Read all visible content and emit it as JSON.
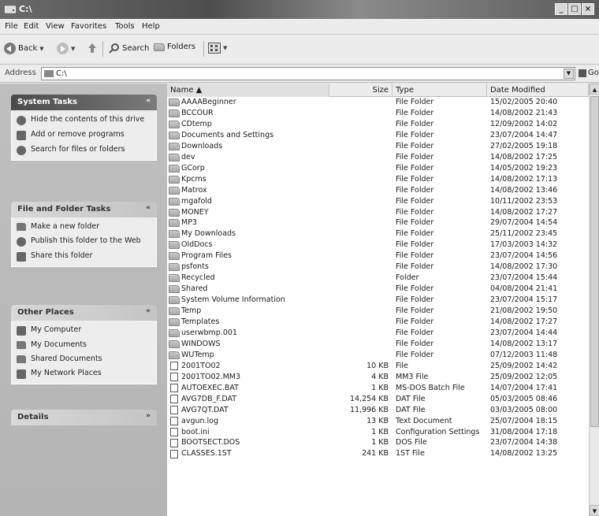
{
  "window": {
    "title": "C:\\"
  },
  "title_buttons": {
    "minimize": "_",
    "maximize": "□",
    "close": "×"
  },
  "menu": [
    "File",
    "Edit",
    "View",
    "Favorites",
    "Tools",
    "Help"
  ],
  "toolbar": {
    "back": "Back",
    "search": "Search",
    "folders": "Folders"
  },
  "address": {
    "label": "Address",
    "value": "C:\\",
    "go": "Go"
  },
  "task_panes": {
    "system_tasks": {
      "title": "System Tasks",
      "items": [
        "Hide the contents of this drive",
        "Add or remove programs",
        "Search for files or folders"
      ]
    },
    "file_folder_tasks": {
      "title": "File and Folder Tasks",
      "items": [
        "Make a new folder",
        "Publish this folder to the Web",
        "Share this folder"
      ]
    },
    "other_places": {
      "title": "Other Places",
      "items": [
        "My Computer",
        "My Documents",
        "Shared Documents",
        "My Network Places"
      ]
    },
    "details": {
      "title": "Details"
    }
  },
  "columns": {
    "name": "Name ▲",
    "size": "Size",
    "type": "Type",
    "date": "Date Modified"
  },
  "files": [
    {
      "name": "AAAABeginner",
      "size": "",
      "type": "File Folder",
      "date": "15/02/2005 20:40",
      "kind": "folder"
    },
    {
      "name": "BCCOUR",
      "size": "",
      "type": "File Folder",
      "date": "14/08/2002 21:43",
      "kind": "folder"
    },
    {
      "name": "CDtemp",
      "size": "",
      "type": "File Folder",
      "date": "12/09/2002 14:02",
      "kind": "folder"
    },
    {
      "name": "Documents and Settings",
      "size": "",
      "type": "File Folder",
      "date": "23/07/2004 14:47",
      "kind": "folder"
    },
    {
      "name": "Downloads",
      "size": "",
      "type": "File Folder",
      "date": "27/02/2005 19:18",
      "kind": "folder"
    },
    {
      "name": "dev",
      "size": "",
      "type": "File Folder",
      "date": "14/08/2002 17:25",
      "kind": "folder"
    },
    {
      "name": "GCorp",
      "size": "",
      "type": "File Folder",
      "date": "14/05/2002 19:23",
      "kind": "folder"
    },
    {
      "name": "Kpcms",
      "size": "",
      "type": "File Folder",
      "date": "14/08/2002 17:13",
      "kind": "folder"
    },
    {
      "name": "Matrox",
      "size": "",
      "type": "File Folder",
      "date": "14/08/2002 13:46",
      "kind": "folder"
    },
    {
      "name": "mgafold",
      "size": "",
      "type": "File Folder",
      "date": "10/11/2002 23:53",
      "kind": "folder"
    },
    {
      "name": "MONEY",
      "size": "",
      "type": "File Folder",
      "date": "14/08/2002 17:27",
      "kind": "folder"
    },
    {
      "name": "MP3",
      "size": "",
      "type": "File Folder",
      "date": "29/07/2004 14:54",
      "kind": "folder"
    },
    {
      "name": "My Downloads",
      "size": "",
      "type": "File Folder",
      "date": "25/11/2002 23:45",
      "kind": "folder"
    },
    {
      "name": "OldDocs",
      "size": "",
      "type": "File Folder",
      "date": "17/03/2003 14:32",
      "kind": "folder"
    },
    {
      "name": "Program Files",
      "size": "",
      "type": "File Folder",
      "date": "23/07/2004 14:56",
      "kind": "folder"
    },
    {
      "name": "psfonts",
      "size": "",
      "type": "File Folder",
      "date": "14/08/2002 17:30",
      "kind": "folder"
    },
    {
      "name": "Recycled",
      "size": "",
      "type": "Folder",
      "date": "23/07/2004 15:44",
      "kind": "folder"
    },
    {
      "name": "Shared",
      "size": "",
      "type": "File Folder",
      "date": "04/08/2004 21:41",
      "kind": "folder"
    },
    {
      "name": "System Volume Information",
      "size": "",
      "type": "File Folder",
      "date": "23/07/2004 15:17",
      "kind": "folder"
    },
    {
      "name": "Temp",
      "size": "",
      "type": "File Folder",
      "date": "21/08/2002 19:50",
      "kind": "folder"
    },
    {
      "name": "Templates",
      "size": "",
      "type": "File Folder",
      "date": "14/08/2002 17:27",
      "kind": "folder"
    },
    {
      "name": "userwbmp.001",
      "size": "",
      "type": "File Folder",
      "date": "23/07/2004 14:44",
      "kind": "folder"
    },
    {
      "name": "WINDOWS",
      "size": "",
      "type": "File Folder",
      "date": "14/08/2002 13:17",
      "kind": "folder"
    },
    {
      "name": "WUTemp",
      "size": "",
      "type": "File Folder",
      "date": "07/12/2003 11:48",
      "kind": "folder"
    },
    {
      "name": "2001TO02",
      "size": "10 KB",
      "type": "File",
      "date": "25/09/2002 14:42",
      "kind": "file"
    },
    {
      "name": "2001TO02.MM3",
      "size": "4 KB",
      "type": "MM3 File",
      "date": "25/09/2002 12:05",
      "kind": "file"
    },
    {
      "name": "AUTOEXEC.BAT",
      "size": "1 KB",
      "type": "MS-DOS Batch File",
      "date": "14/07/2004 17:41",
      "kind": "file"
    },
    {
      "name": "AVG7DB_F.DAT",
      "size": "14,254 KB",
      "type": "DAT File",
      "date": "05/03/2005 08:46",
      "kind": "file"
    },
    {
      "name": "AVG7QT.DAT",
      "size": "11,996 KB",
      "type": "DAT File",
      "date": "03/03/2005 08:00",
      "kind": "file"
    },
    {
      "name": "avgun.log",
      "size": "13 KB",
      "type": "Text Document",
      "date": "25/07/2004 18:15",
      "kind": "file"
    },
    {
      "name": "boot.ini",
      "size": "1 KB",
      "type": "Configuration Settings",
      "date": "31/08/2004 17:18",
      "kind": "file"
    },
    {
      "name": "BOOTSECT.DOS",
      "size": "1 KB",
      "type": "DOS File",
      "date": "23/07/2004 14:38",
      "kind": "file"
    },
    {
      "name": "CLASSES.1ST",
      "size": "241 KB",
      "type": "1ST File",
      "date": "14/08/2002 13:25",
      "kind": "file"
    }
  ]
}
